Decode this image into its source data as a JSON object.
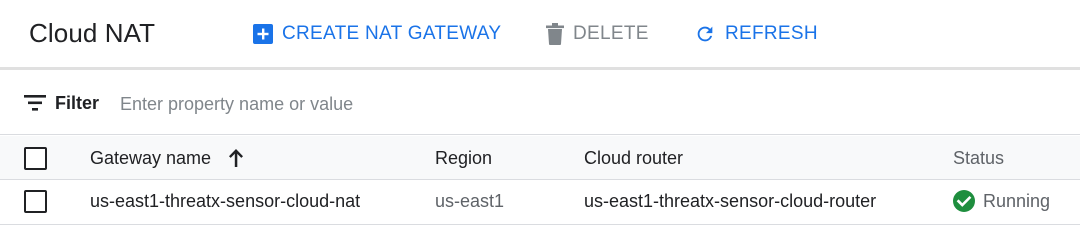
{
  "header": {
    "title": "Cloud NAT",
    "actions": {
      "create": {
        "label": "CREATE NAT GATEWAY",
        "icon": "add-box-icon"
      },
      "delete": {
        "label": "DELETE",
        "icon": "trash-icon"
      },
      "refresh": {
        "label": "REFRESH",
        "icon": "refresh-icon"
      }
    }
  },
  "filter": {
    "label": "Filter",
    "icon": "filter-icon",
    "placeholder": "Enter property name or value",
    "value": ""
  },
  "table": {
    "columns": {
      "name": "Gateway name",
      "region": "Region",
      "router": "Cloud router",
      "status": "Status"
    },
    "sort": {
      "column": "Gateway name",
      "direction": "ascending",
      "icon": "arrow-up-icon"
    },
    "rows": [
      {
        "name": "us-east1-threatx-sensor-cloud-nat",
        "region": "us-east1",
        "router": "us-east1-threatx-sensor-cloud-router",
        "status": "Running",
        "status_icon": "check-circle-icon"
      }
    ]
  },
  "colors": {
    "accent": "#1a73e8",
    "disabled": "#80868b",
    "success": "#1e8e3e",
    "text": "#202124",
    "secondary_text": "#5f6368"
  }
}
